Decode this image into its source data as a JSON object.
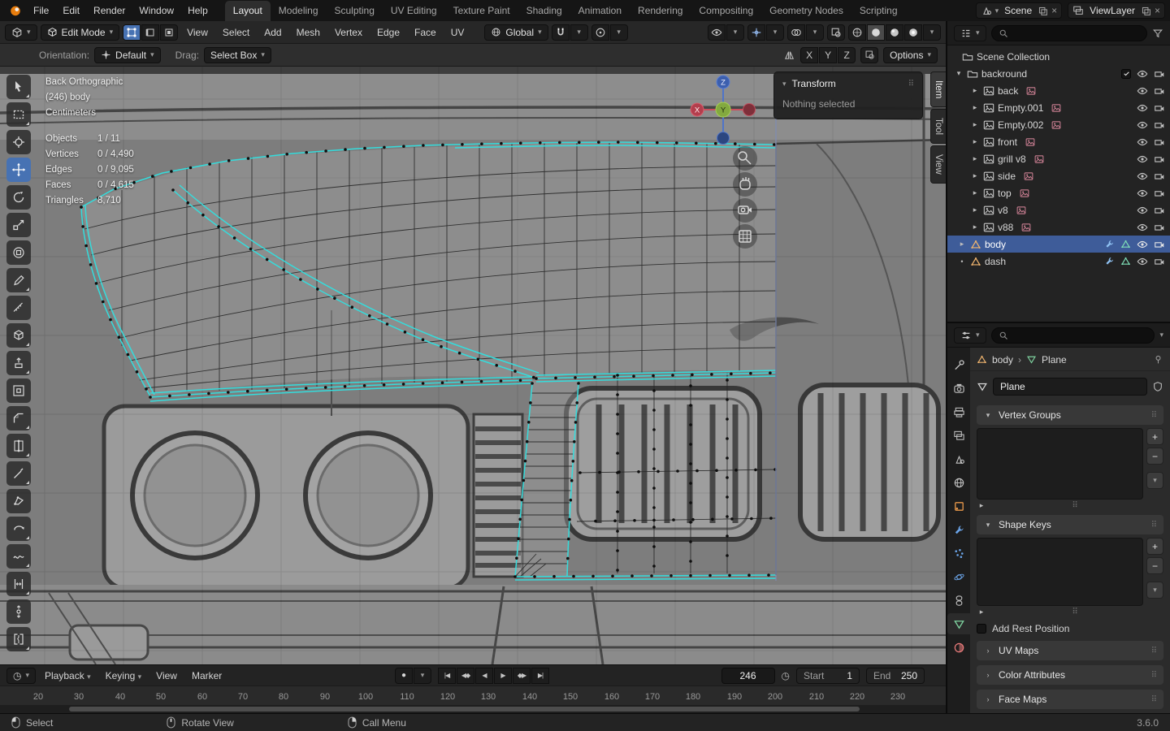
{
  "topbar": {
    "menus": [
      "File",
      "Edit",
      "Render",
      "Window",
      "Help"
    ],
    "tabs": [
      {
        "label": "Layout"
      },
      {
        "label": "Modeling"
      },
      {
        "label": "Sculpting"
      },
      {
        "label": "UV Editing"
      },
      {
        "label": "Texture Paint"
      },
      {
        "label": "Shading"
      },
      {
        "label": "Animation"
      },
      {
        "label": "Rendering"
      },
      {
        "label": "Compositing"
      },
      {
        "label": "Geometry Nodes"
      },
      {
        "label": "Scripting"
      }
    ],
    "active_tab": "Layout",
    "scene_label": "Scene",
    "view_layer_label": "ViewLayer"
  },
  "viewport_header": {
    "mode": "Edit Mode",
    "menus": [
      "View",
      "Select",
      "Add",
      "Mesh",
      "Vertex",
      "Edge",
      "Face",
      "UV"
    ],
    "orientation": "Global"
  },
  "tool_settings": {
    "orientation_label": "Orientation:",
    "orientation_value": "Default",
    "drag_label": "Drag:",
    "drag_value": "Select Box",
    "axis_x": "X",
    "axis_y": "Y",
    "axis_z": "Z",
    "options_label": "Options"
  },
  "viewport": {
    "view_name": "Back Orthographic",
    "active_object": "(246) body",
    "units": "Centimeters",
    "stats": [
      {
        "label": "Objects",
        "value": "1 / 11"
      },
      {
        "label": "Vertices",
        "value": "0 / 4,490"
      },
      {
        "label": "Edges",
        "value": "0 / 9,095"
      },
      {
        "label": "Faces",
        "value": "0 / 4,615"
      },
      {
        "label": "Triangles",
        "value": "8,710"
      }
    ],
    "transform_panel": {
      "title": "Transform",
      "message": "Nothing selected"
    },
    "side_tabs": [
      "Item",
      "Tool",
      "View"
    ],
    "gizmo": {
      "x": "X",
      "y": "Y",
      "z": "Z"
    }
  },
  "outliner": {
    "root": "Scene Collection",
    "items": [
      {
        "label": "backround"
      },
      {
        "label": "back"
      },
      {
        "label": "Empty.001"
      },
      {
        "label": "Empty.002"
      },
      {
        "label": "front"
      },
      {
        "label": "grill v8"
      },
      {
        "label": "side"
      },
      {
        "label": "top"
      },
      {
        "label": "v8"
      },
      {
        "label": "v88"
      },
      {
        "label": "body"
      },
      {
        "label": "dash"
      }
    ]
  },
  "properties": {
    "breadcrumb": {
      "object": "body",
      "data": "Plane"
    },
    "name_value": "Plane",
    "vertex_groups_title": "Vertex Groups",
    "shape_keys_title": "Shape Keys",
    "add_rest_position": "Add Rest Position",
    "uv_maps_title": "UV Maps",
    "color_attributes_title": "Color Attributes",
    "face_maps_title": "Face Maps"
  },
  "timeline": {
    "menus": [
      "Playback",
      "Keying",
      "View",
      "Marker"
    ],
    "record": "●",
    "clock": "◷",
    "transport": [
      "|◀",
      "◀◆",
      "◀",
      "▶",
      "◆▶",
      "▶|"
    ],
    "current_frame": "246",
    "start_label": "Start",
    "start_value": "1",
    "end_label": "End",
    "end_value": "250",
    "ticks": [
      "20",
      "30",
      "40",
      "50",
      "60",
      "70",
      "80",
      "90",
      "100",
      "110",
      "120",
      "130",
      "140",
      "150",
      "160",
      "170",
      "180",
      "190",
      "200",
      "210",
      "220",
      "230"
    ]
  },
  "status_bar": {
    "hints": [
      "Select",
      "Rotate View",
      "Call Menu"
    ],
    "version": "3.6.0"
  },
  "icons": {
    "chevron_down": "▾",
    "expand_right": "▸",
    "expand_down": "▾",
    "collapse_right": "›",
    "plus": "+",
    "minus": "−",
    "grip": "⠿",
    "dot": "•",
    "close": "×"
  }
}
